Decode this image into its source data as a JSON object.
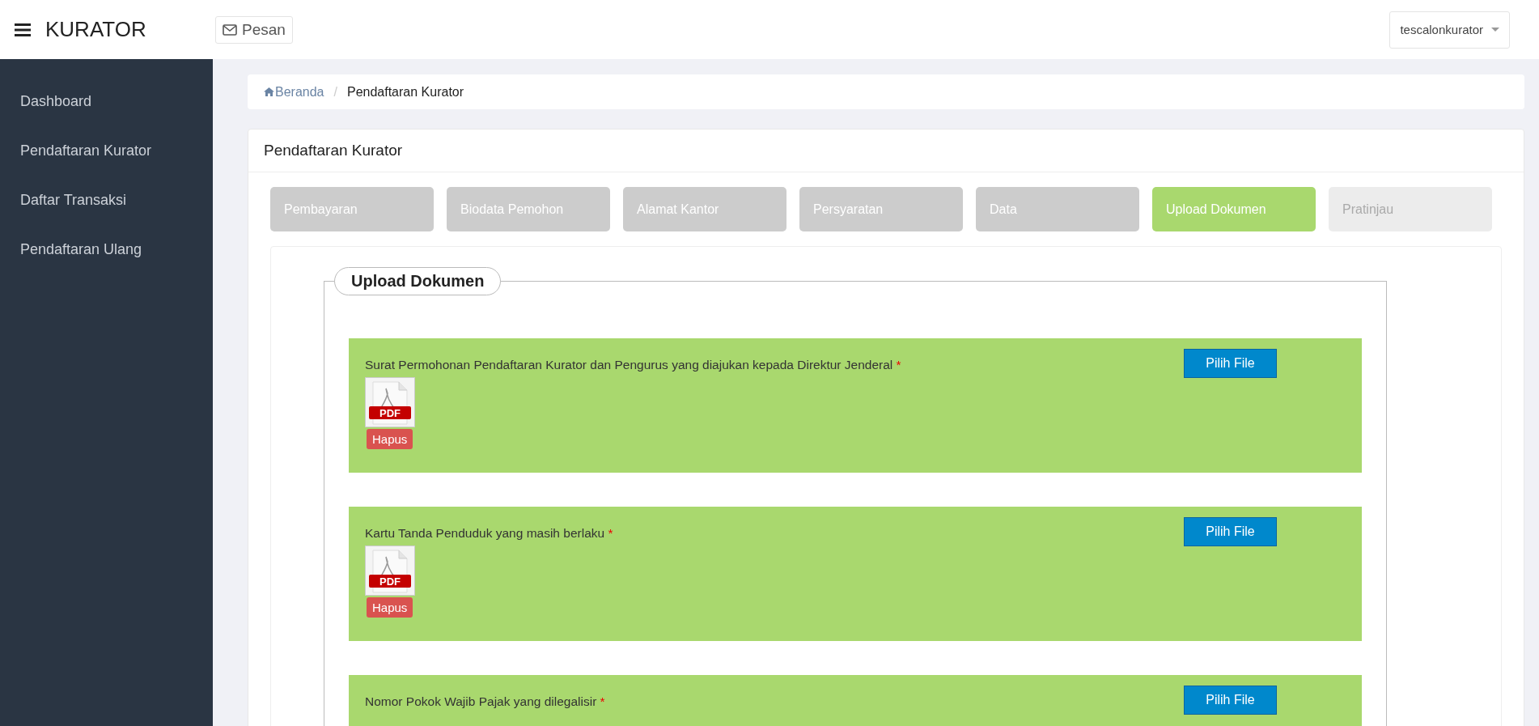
{
  "app": {
    "title": "KURATOR"
  },
  "topbar": {
    "message_button": "Pesan",
    "user_menu": "tescalonkurator"
  },
  "sidebar": {
    "items": [
      {
        "label": "Dashboard",
        "selected": false
      },
      {
        "label": "Pendaftaran Kurator",
        "selected": false
      },
      {
        "label": "Daftar Transaksi",
        "selected": false
      },
      {
        "label": "Pendaftaran Ulang",
        "selected": false
      }
    ]
  },
  "breadcrumb": [
    {
      "label": "Beranda",
      "kind": "link"
    },
    {
      "label": "/",
      "kind": "separator"
    },
    {
      "label": "Pendaftaran Kurator",
      "kind": "current"
    }
  ],
  "panel": {
    "title": "Pendaftaran Kurator"
  },
  "steps": [
    {
      "label": "Pembayaran",
      "selected": false,
      "completed": true
    },
    {
      "label": "Biodata Pemohon",
      "selected": false,
      "completed": true
    },
    {
      "label": "Alamat Kantor",
      "selected": false,
      "completed": true
    },
    {
      "label": "Persyaratan",
      "selected": false,
      "completed": true
    },
    {
      "label": "Data",
      "selected": false,
      "completed": true
    },
    {
      "label": "Upload Dokumen",
      "selected": true,
      "completed": false
    },
    {
      "label": "Pratinjau",
      "selected": false,
      "completed": false
    }
  ],
  "upload_section": {
    "legend": "Upload Dokumen",
    "documents": [
      {
        "label": "Surat Permohonan Pendaftaran Kurator dan Pengurus yang diajukan kepada Direktur Jenderal",
        "required_mark": "*",
        "button": "Pilih File",
        "file": {
          "badge": "PDF",
          "delete_button": "Hapus"
        }
      },
      {
        "label": "Kartu Tanda Penduduk yang masih berlaku",
        "required_mark": "*",
        "button": "Pilih File",
        "file": {
          "badge": "PDF",
          "delete_button": "Hapus"
        }
      },
      {
        "label": "Nomor Pokok Wajib Pajak yang dilegalisir",
        "required_mark": "*",
        "button": "Pilih File"
      }
    ]
  }
}
